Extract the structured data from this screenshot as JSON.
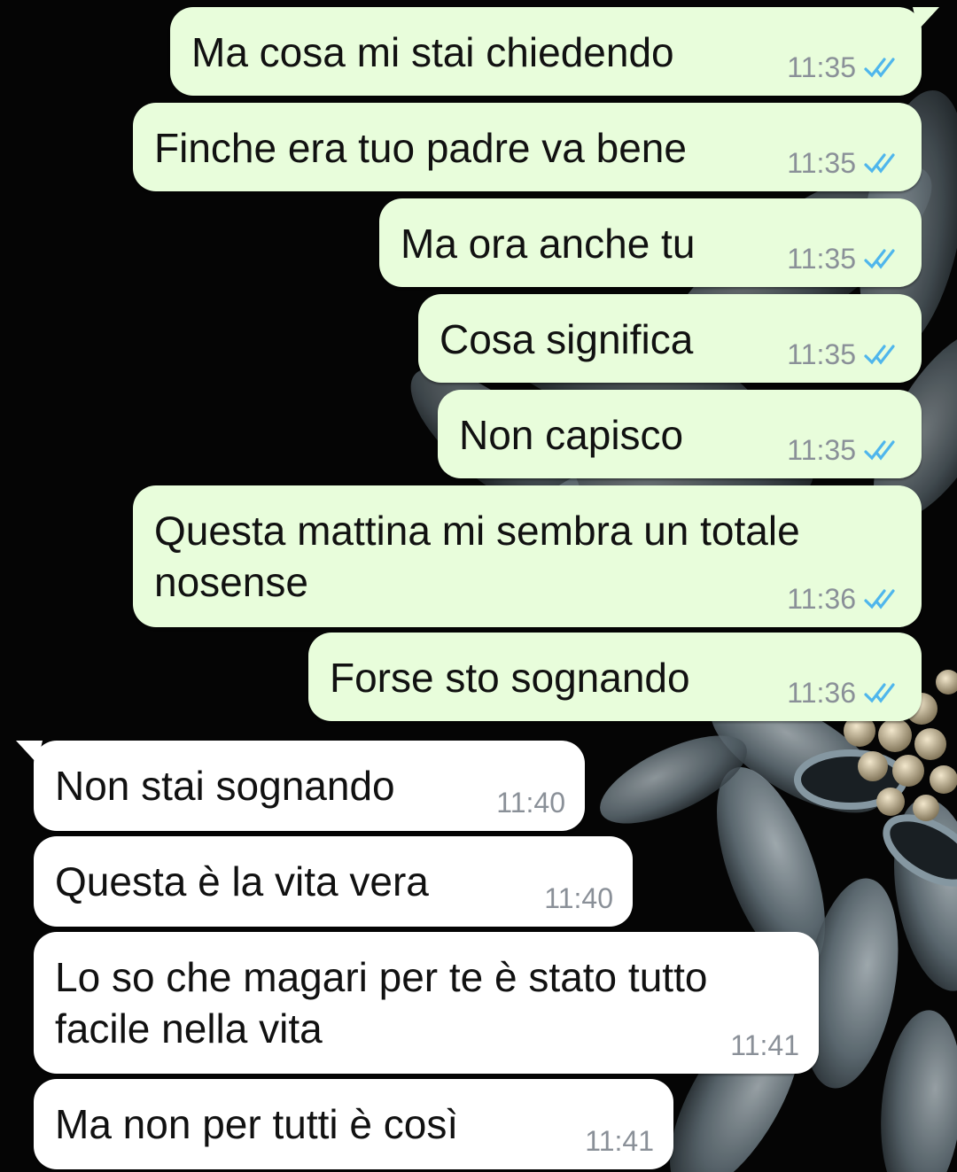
{
  "outgoing": [
    {
      "text": "Ma cosa mi stai chiedendo",
      "time": "11:35"
    },
    {
      "text": "Finche era tuo padre va bene",
      "time": "11:35"
    },
    {
      "text": "Ma ora anche tu",
      "time": "11:35"
    },
    {
      "text": "Cosa significa",
      "time": "11:35"
    },
    {
      "text": "Non capisco",
      "time": "11:35"
    },
    {
      "text": "Questa mattina mi sembra un totale\nnosense",
      "time": "11:36"
    },
    {
      "text": "Forse sto sognando",
      "time": "11:36"
    }
  ],
  "incoming": [
    {
      "text": "Non stai sognando",
      "time": "11:40"
    },
    {
      "text": "Questa è la vita vera",
      "time": "11:40"
    },
    {
      "text": "Lo so che magari per te è stato tutto\nfacile nella vita",
      "time": "11:41"
    },
    {
      "text": "Ma non per tutti è così",
      "time": "11:41"
    }
  ],
  "receipt_icon": "double-check-read-icon",
  "colors": {
    "outgoing_bubble": "#e8fddb",
    "incoming_bubble": "#ffffff",
    "read_check": "#4fb6ec",
    "timestamp": "#8a9098",
    "wallpaper": "#050505"
  }
}
